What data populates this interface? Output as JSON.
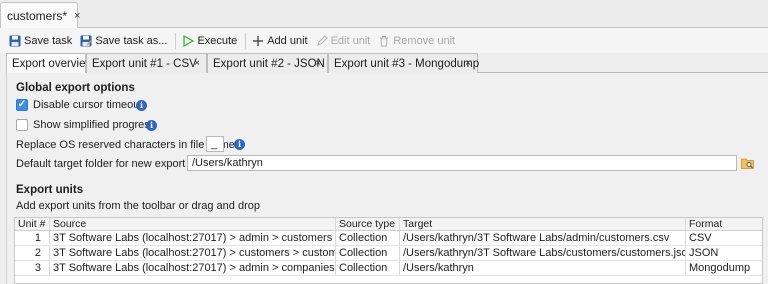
{
  "editor_tab": {
    "title": "customers*",
    "close": "×"
  },
  "toolbar": {
    "save_task": "Save task",
    "save_task_as": "Save task as...",
    "execute": "Execute",
    "add_unit": "Add unit",
    "edit_unit": "Edit unit",
    "remove_unit": "Remove unit"
  },
  "tabs": [
    {
      "label": "Export overview",
      "active": true
    },
    {
      "label": "Export unit #1 - CSV",
      "close": "×"
    },
    {
      "label": "Export unit #2 - JSON",
      "close": "×"
    },
    {
      "label": "Export unit #3 - Mongodump",
      "close": "×"
    }
  ],
  "global": {
    "title": "Global export options",
    "disable_cursor_timeout": {
      "label": "Disable cursor timeout",
      "checked": true,
      "check_glyph": "✓"
    },
    "show_simplified_progress": {
      "label": "Show simplified progress",
      "checked": false
    },
    "replace_os_label": "Replace OS reserved characters in file names:",
    "replace_os_value": "_",
    "default_folder_label": "Default target folder for new export units:",
    "default_folder_value": "/Users/kathryn",
    "info_glyph": "i"
  },
  "units": {
    "title": "Export units",
    "hint": "Add export units from the toolbar or drag and drop",
    "columns": [
      "Unit #",
      "Source",
      "Source type",
      "Target",
      "Format"
    ],
    "rows": [
      {
        "unit": "1",
        "source": "3T Software Labs (localhost:27017) > admin > customers",
        "type": "Collection",
        "target": "/Users/kathryn/3T Software Labs/admin/customers.csv",
        "format": "CSV"
      },
      {
        "unit": "2",
        "source": "3T Software Labs (localhost:27017) > customers > customers",
        "type": "Collection",
        "target": "/Users/kathryn/3T Software Labs/customers/customers.json",
        "format": "JSON"
      },
      {
        "unit": "3",
        "source": "3T Software Labs (localhost:27017) > admin > companies",
        "type": "Collection",
        "target": "/Users/kathryn",
        "format": "Mongodump"
      }
    ]
  },
  "colors": {
    "accent": "#3d8ee8",
    "info": "#2e64c9",
    "execute_green": "#3fa63f"
  }
}
